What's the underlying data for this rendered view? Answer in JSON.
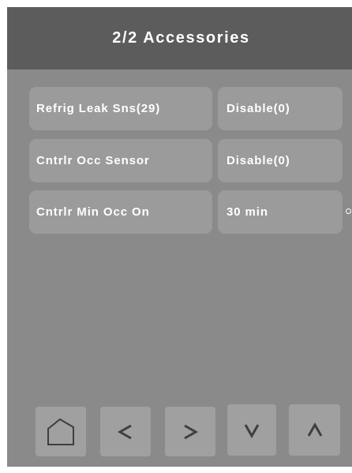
{
  "header": {
    "title": "2/2 Accessories"
  },
  "settings": [
    {
      "label": "Refrig Leak Sns(29)",
      "value": "Disable(0)"
    },
    {
      "label": "Cntrlr Occ Sensor",
      "value": "Disable(0)"
    },
    {
      "label": "Cntrlr Min Occ On",
      "value": "30 min"
    }
  ],
  "nav": {
    "home_icon": "home-icon",
    "prev_icon": "chevron-left-icon",
    "next_icon": "chevron-right-icon",
    "down_icon": "chevron-down-icon",
    "up_icon": "chevron-up-icon"
  },
  "colors": {
    "screen_background": "#8a8a8a",
    "header_background": "#5c5c5c",
    "cell_background": "#9b9b9b",
    "button_background": "#a0a0a0",
    "icon_stroke": "#3f3f3f",
    "text": "#ffffff"
  }
}
